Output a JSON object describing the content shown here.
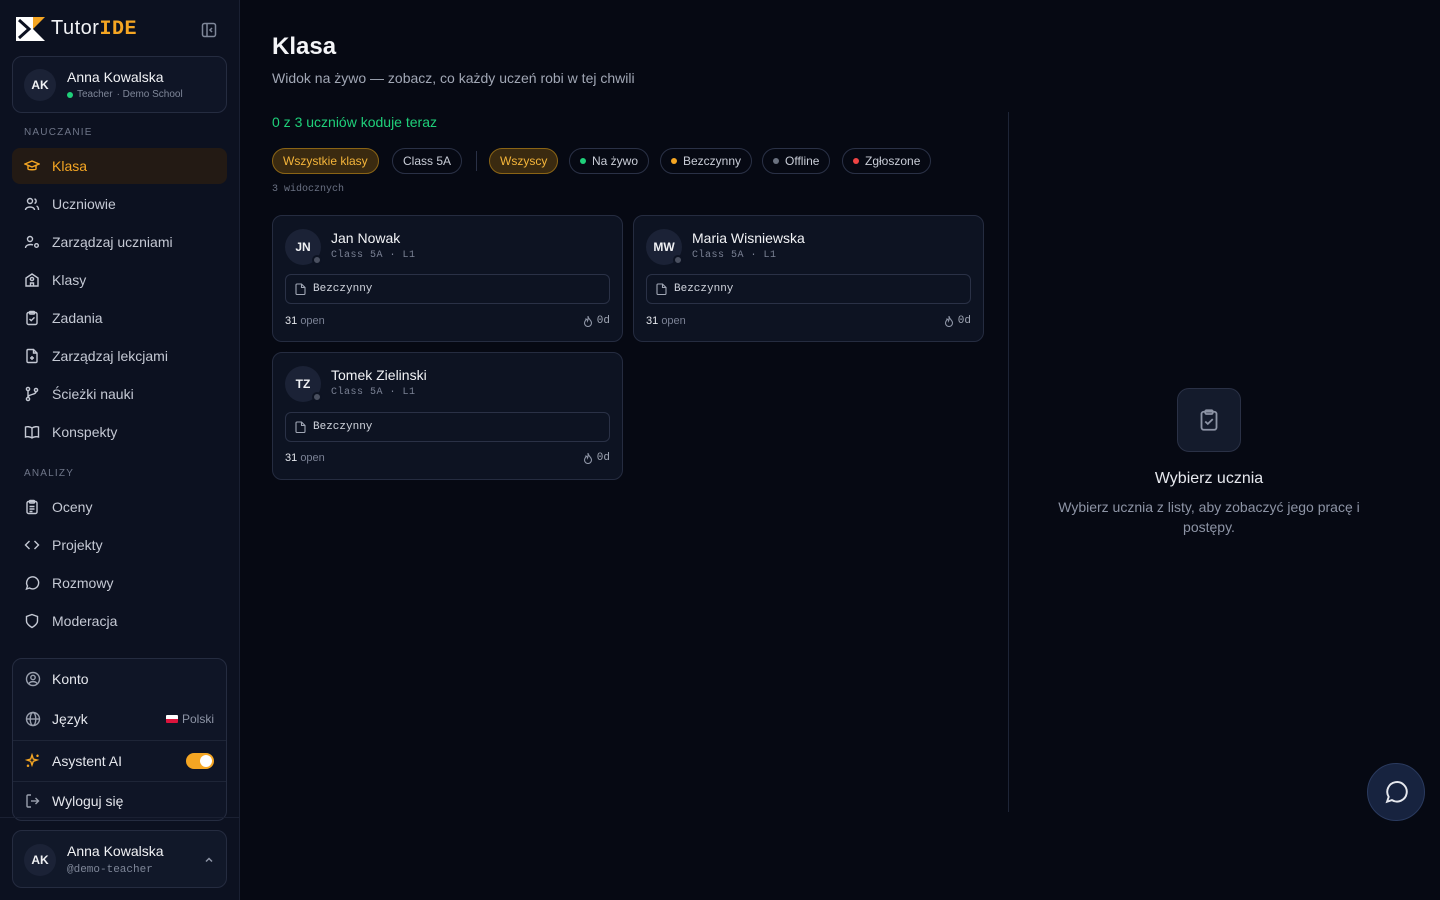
{
  "app": {
    "name_prefix": "Tutor",
    "name_suffix": "IDE"
  },
  "user": {
    "initials": "AK",
    "name": "Anna Kowalska",
    "role": "Teacher",
    "school": "· Demo School",
    "handle": "@demo-teacher"
  },
  "sidebar": {
    "section_teaching": "NAUCZANIE",
    "section_analytics": "ANALIZY",
    "teaching": [
      {
        "label": "Klasa",
        "icon": "graduation-cap-icon"
      },
      {
        "label": "Uczniowie",
        "icon": "users-icon"
      },
      {
        "label": "Zarządzaj uczniami",
        "icon": "user-cog-icon"
      },
      {
        "label": "Klasy",
        "icon": "school-icon"
      },
      {
        "label": "Zadania",
        "icon": "clipboard-icon"
      },
      {
        "label": "Zarządzaj lekcjami",
        "icon": "file-plus-icon"
      },
      {
        "label": "Ścieżki nauki",
        "icon": "git-branch-icon"
      },
      {
        "label": "Konspekty",
        "icon": "book-open-icon"
      }
    ],
    "analytics": [
      {
        "label": "Oceny",
        "icon": "clipboard-list-icon"
      },
      {
        "label": "Projekty",
        "icon": "code-icon"
      },
      {
        "label": "Rozmowy",
        "icon": "message-circle-icon"
      },
      {
        "label": "Moderacja",
        "icon": "shield-icon"
      }
    ],
    "menu": {
      "account": "Konto",
      "language": "Język",
      "language_value": "Polski",
      "ai": "Asystent AI",
      "ai_enabled": true,
      "logout": "Wyloguj się"
    }
  },
  "main": {
    "title": "Klasa",
    "subtitle": "Widok na żywo — zobacz, co każdy uczeń robi w tej chwili",
    "coding_status": "0 z 3 uczniów koduje teraz",
    "class_filters": [
      "Wszystkie klasy",
      "Class 5A"
    ],
    "status_filters": [
      {
        "label": "Wszyscy",
        "dot": null
      },
      {
        "label": "Na żywo",
        "dot": "#1fd07a"
      },
      {
        "label": "Bezczynny",
        "dot": "#f5a623"
      },
      {
        "label": "Offline",
        "dot": "#6b7280"
      },
      {
        "label": "Zgłoszone",
        "dot": "#ef4444"
      }
    ],
    "visible_count": "3 widocznych",
    "students": [
      {
        "initials": "JN",
        "name": "Jan Nowak",
        "class": "Class 5A",
        "level": "L1",
        "status": "Bezczynny",
        "open": "31",
        "open_label": "open",
        "streak": "0d"
      },
      {
        "initials": "MW",
        "name": "Maria Wisniewska",
        "class": "Class 5A",
        "level": "L1",
        "status": "Bezczynny",
        "open": "31",
        "open_label": "open",
        "streak": "0d"
      },
      {
        "initials": "TZ",
        "name": "Tomek Zielinski",
        "class": "Class 5A",
        "level": "L1",
        "status": "Bezczynny",
        "open": "31",
        "open_label": "open",
        "streak": "0d"
      }
    ],
    "empty": {
      "title": "Wybierz ucznia",
      "desc": "Wybierz ucznia z listy, aby zobaczyć jego pracę i postępy."
    }
  },
  "colors": {
    "accent": "#f5a623",
    "live": "#1fd07a",
    "flagged": "#ef4444",
    "bg": "#060913"
  }
}
